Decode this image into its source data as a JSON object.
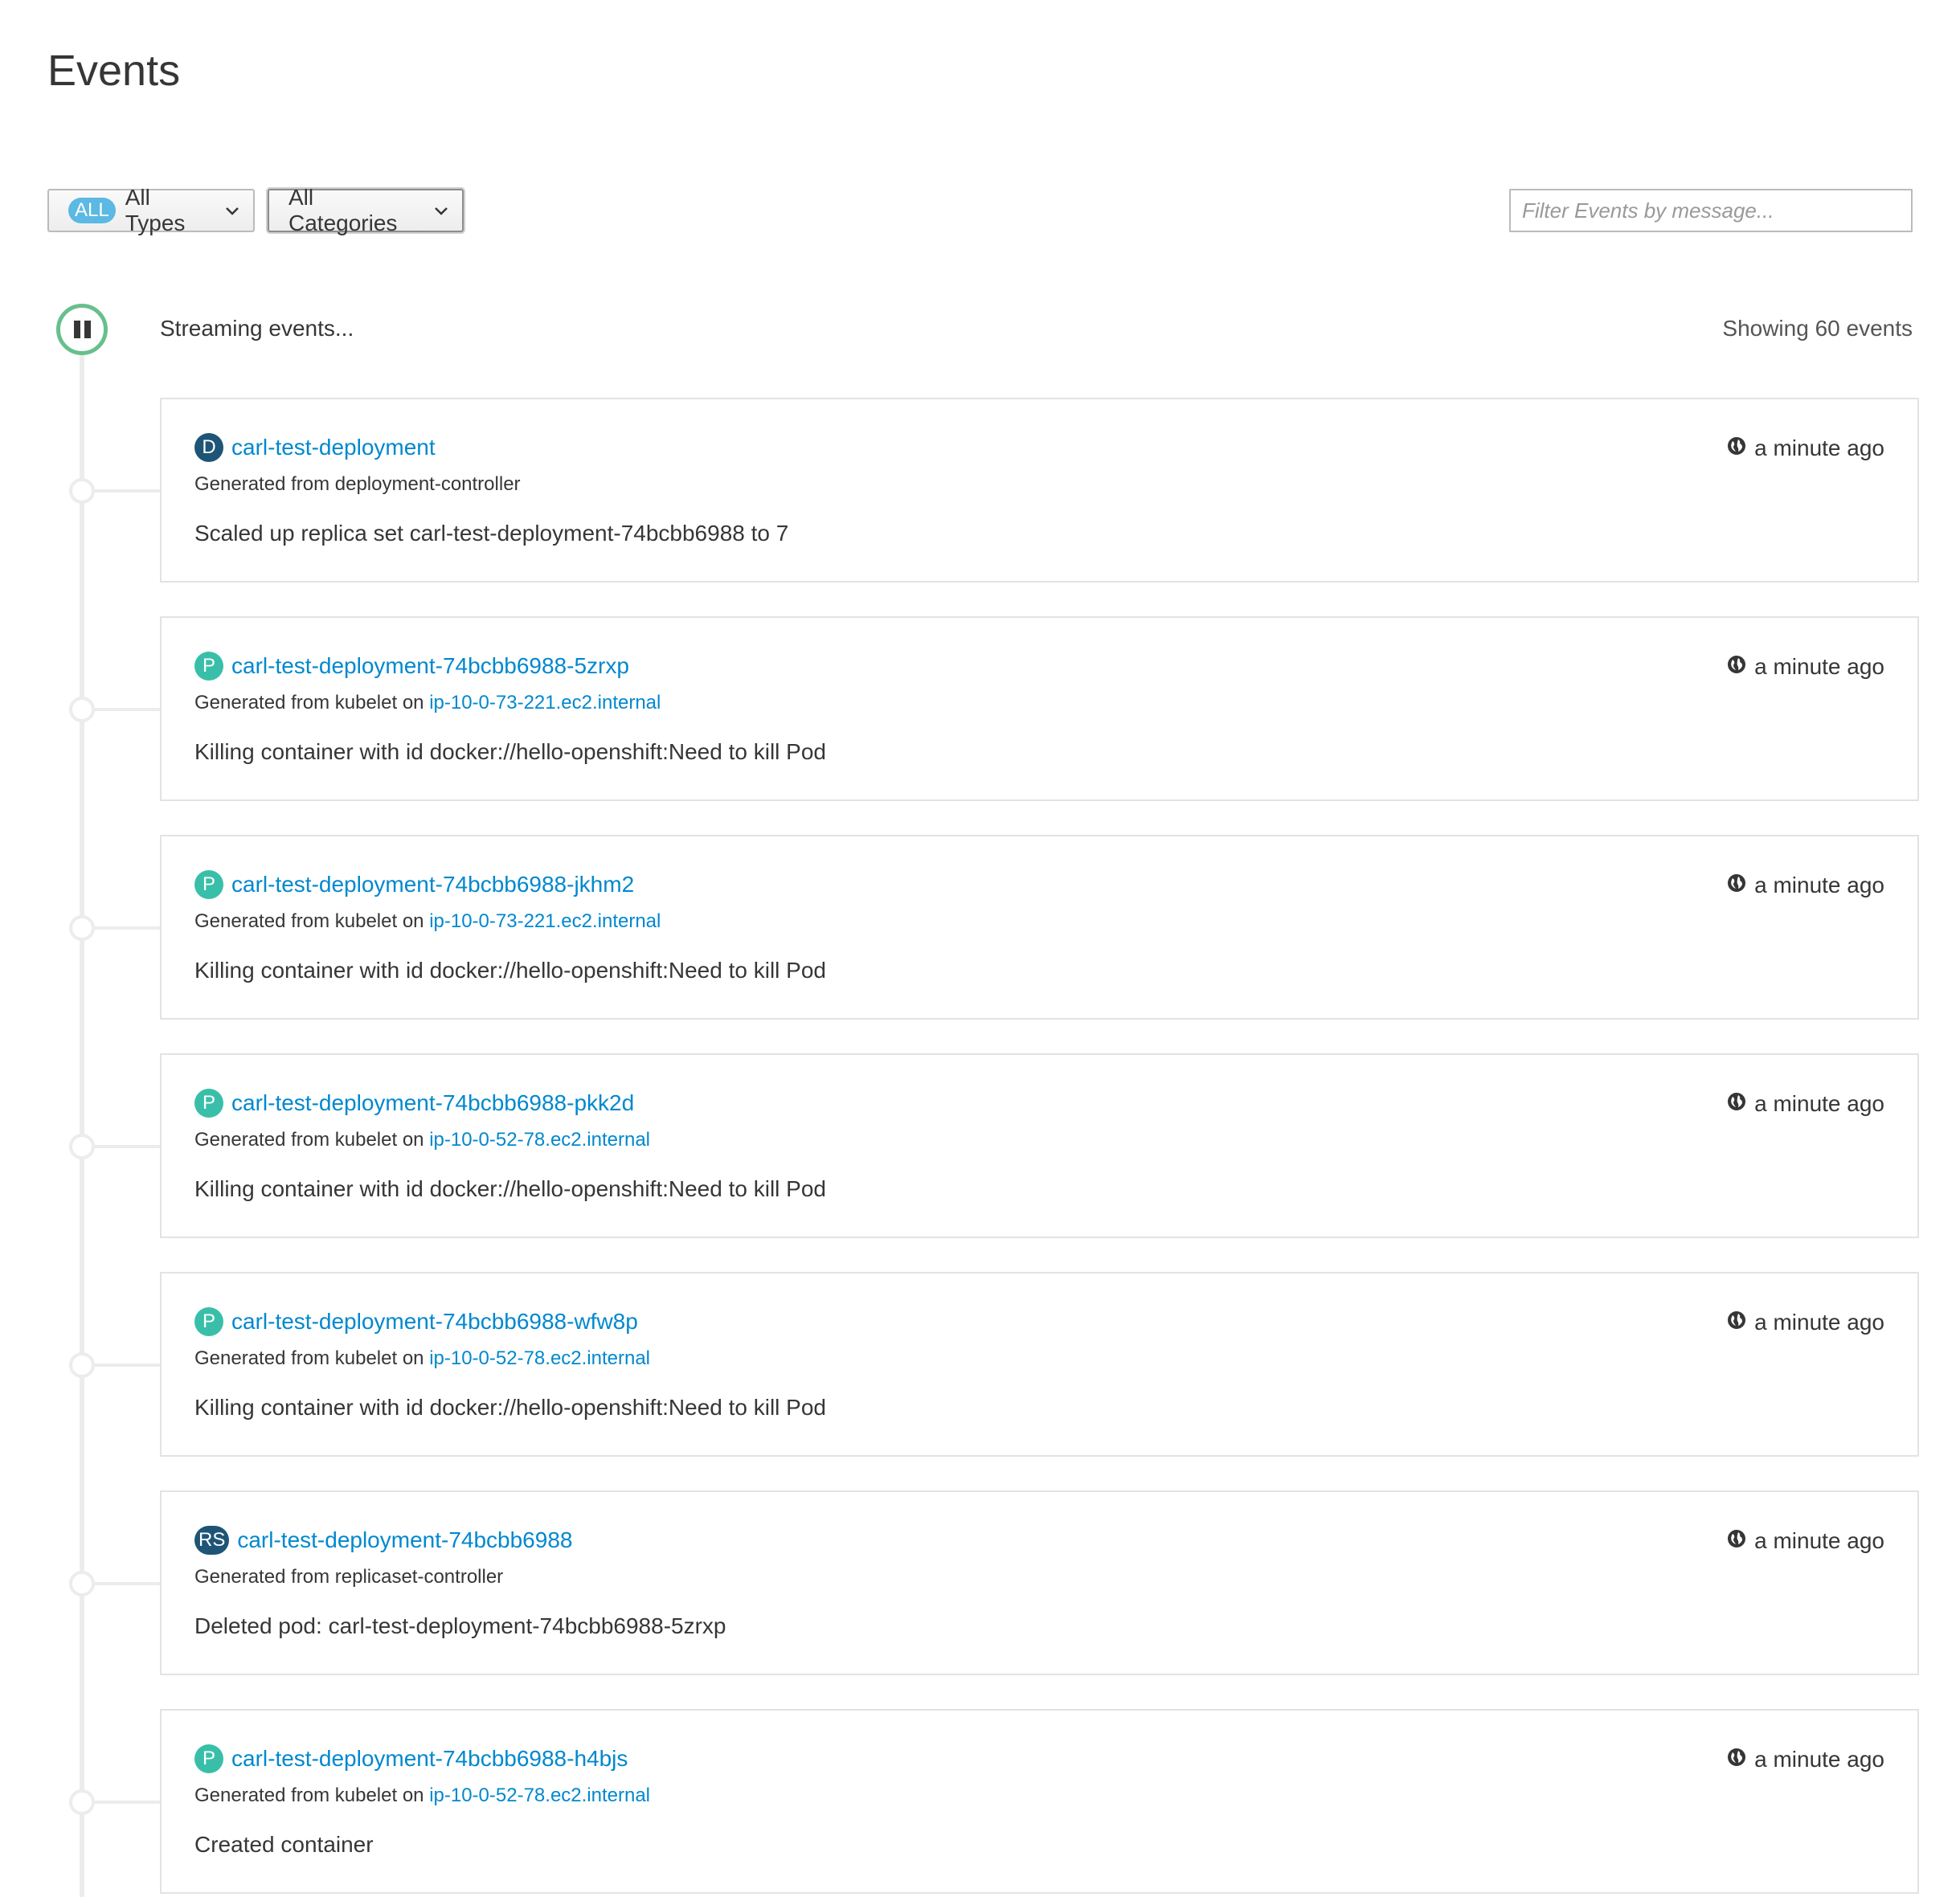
{
  "page": {
    "title": "Events"
  },
  "filters": {
    "types_badge": "ALL",
    "types_label": "All Types",
    "categories_label": "All Categories",
    "search_placeholder": "Filter Events by message..."
  },
  "stream": {
    "status": "Streaming events...",
    "count": "Showing 60 events"
  },
  "colors": {
    "link": "#0088ce",
    "pod_badge": "#39bfa9",
    "deployment_badge": "#1e5577",
    "stream_ring": "#67c08c"
  },
  "events": [
    {
      "kind": "D",
      "name": "carl-test-deployment",
      "source_prefix": "Generated from deployment-controller",
      "source_on": "",
      "source_node": "",
      "message": "Scaled up replica set carl-test-deployment-74bcbb6988 to 7",
      "time": "a minute ago"
    },
    {
      "kind": "P",
      "name": "carl-test-deployment-74bcbb6988-5zrxp",
      "source_prefix": "Generated from kubelet",
      "source_on": "on",
      "source_node": "ip-10-0-73-221.ec2.internal",
      "message": "Killing container with id docker://hello-openshift:Need to kill Pod",
      "time": "a minute ago"
    },
    {
      "kind": "P",
      "name": "carl-test-deployment-74bcbb6988-jkhm2",
      "source_prefix": "Generated from kubelet",
      "source_on": "on",
      "source_node": "ip-10-0-73-221.ec2.internal",
      "message": "Killing container with id docker://hello-openshift:Need to kill Pod",
      "time": "a minute ago"
    },
    {
      "kind": "P",
      "name": "carl-test-deployment-74bcbb6988-pkk2d",
      "source_prefix": "Generated from kubelet",
      "source_on": "on",
      "source_node": "ip-10-0-52-78.ec2.internal",
      "message": "Killing container with id docker://hello-openshift:Need to kill Pod",
      "time": "a minute ago"
    },
    {
      "kind": "P",
      "name": "carl-test-deployment-74bcbb6988-wfw8p",
      "source_prefix": "Generated from kubelet",
      "source_on": "on",
      "source_node": "ip-10-0-52-78.ec2.internal",
      "message": "Killing container with id docker://hello-openshift:Need to kill Pod",
      "time": "a minute ago"
    },
    {
      "kind": "RS",
      "name": "carl-test-deployment-74bcbb6988",
      "source_prefix": "Generated from replicaset-controller",
      "source_on": "",
      "source_node": "",
      "message": "Deleted pod: carl-test-deployment-74bcbb6988-5zrxp",
      "time": "a minute ago"
    },
    {
      "kind": "P",
      "name": "carl-test-deployment-74bcbb6988-h4bjs",
      "source_prefix": "Generated from kubelet",
      "source_on": "on",
      "source_node": "ip-10-0-52-78.ec2.internal",
      "message": "Created container",
      "time": "a minute ago"
    }
  ]
}
